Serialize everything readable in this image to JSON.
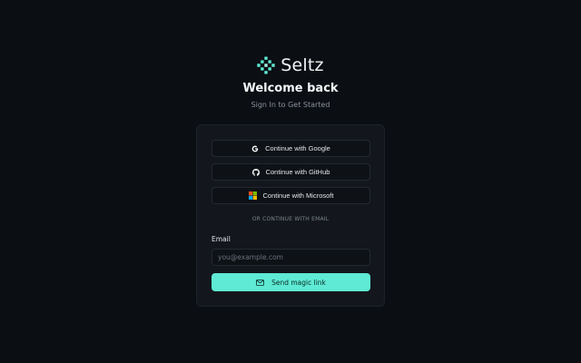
{
  "brand": {
    "name": "Seltz",
    "accent_color": "#5eead4",
    "logo_icon": "diamond-dots-logo-icon"
  },
  "header": {
    "title": "Welcome back",
    "subtitle": "Sign In to Get Started"
  },
  "auth": {
    "providers": [
      {
        "label": "Continue with Google",
        "icon": "google-icon"
      },
      {
        "label": "Continue with GitHub",
        "icon": "github-icon"
      },
      {
        "label": "Continue with Microsoft",
        "icon": "microsoft-icon"
      }
    ],
    "divider": "OR CONTINUE WITH EMAIL",
    "email": {
      "label": "Email",
      "placeholder": "you@example.com",
      "value": ""
    },
    "submit": {
      "label": "Send magic link",
      "icon": "mail-icon"
    }
  }
}
